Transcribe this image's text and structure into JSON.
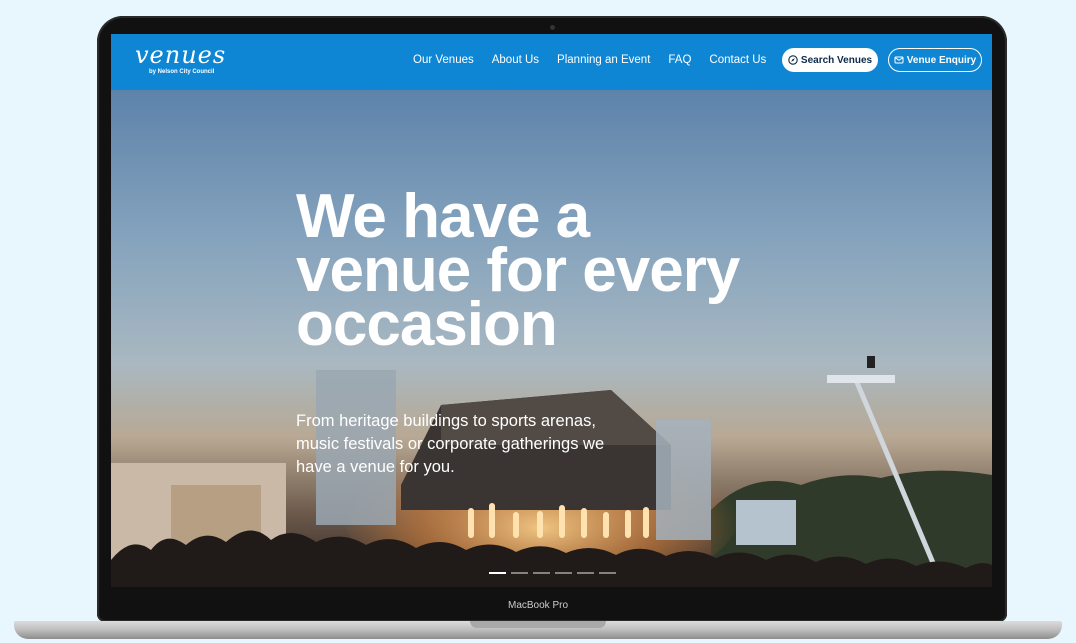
{
  "brand": {
    "logo_word": "venues",
    "logo_sub": "by Nelson City Council"
  },
  "nav": {
    "items": [
      {
        "label": "Our Venues"
      },
      {
        "label": "About Us"
      },
      {
        "label": "Planning an Event"
      },
      {
        "label": "FAQ"
      },
      {
        "label": "Contact Us"
      }
    ]
  },
  "actions": {
    "search_label": "Search Venues",
    "search_icon": "compass-icon",
    "enquiry_label": "Venue Enquiry",
    "enquiry_icon": "envelope-icon"
  },
  "hero": {
    "title_lines": [
      "We have a",
      "venue for every",
      "occasion"
    ],
    "subtitle": "From heritage buildings to sports arenas, music festivals or corporate gatherings we have a venue for you.",
    "slides_total": 6,
    "active_slide": 1
  },
  "device": {
    "label": "MacBook Pro"
  },
  "colors": {
    "header_bg": "#0f86d4",
    "page_bg": "#e8f6fd",
    "button_text": "#0b2a48"
  }
}
